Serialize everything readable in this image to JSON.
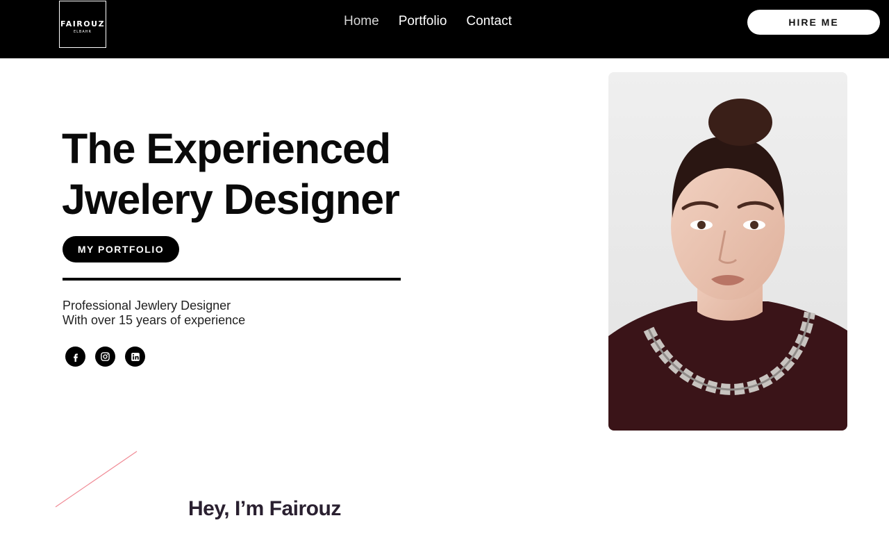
{
  "brand": {
    "line1": "FAIROUZ",
    "line2": "ELBAHR"
  },
  "nav": {
    "items": [
      {
        "label": "Home",
        "active": true
      },
      {
        "label": "Portfolio",
        "active": false
      },
      {
        "label": "Contact",
        "active": false
      }
    ],
    "hire_label": "HIRE ME"
  },
  "hero": {
    "title_line1": "The Experienced",
    "title_line2": "Jwelery Designer",
    "button_label": "MY PORTFOLIO",
    "tagline_line1": "Professional Jewlery Designer",
    "tagline_line2": "With over 15 years of experience"
  },
  "socials": [
    {
      "icon": "facebook-icon"
    },
    {
      "icon": "instagram-icon"
    },
    {
      "icon": "linkedin-icon"
    }
  ],
  "about": {
    "heading": "Hey, I’m Fairouz"
  },
  "colors": {
    "header_bg": "#000000",
    "accent_line": "#f08a95",
    "sweater": "#3a1418"
  }
}
